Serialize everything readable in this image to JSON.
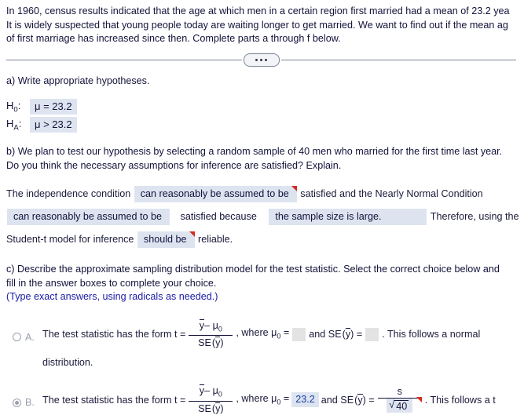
{
  "problem": {
    "line1": "In 1960, census results indicated that the age at which men in a certain region first married had a mean of 23.2 yea",
    "line2": "It is widely suspected that young people today are waiting longer to get married. We want to find out if the mean ag",
    "line3": "of first marriage has increased since then. Complete parts a through f below."
  },
  "divider": {
    "dots_label": "..."
  },
  "part_a": {
    "prompt": "a) Write appropriate hypotheses.",
    "null_label": "H",
    "null_sub": "0",
    "null_value": "μ = 23.2",
    "alt_label": "H",
    "alt_sub": "A",
    "alt_value": "μ > 23.2",
    "colon": ":"
  },
  "part_b": {
    "prompt_line1": "b) We plan to test our hypothesis by selecting a random sample of 40 men who married for the first time last year.",
    "prompt_line2": "Do you think the necessary assumptions for inference are satisfied? Explain.",
    "text1": "The independence condition",
    "dropdown1": "can reasonably be assumed to be",
    "text2": "satisfied and the Nearly Normal Condition",
    "dropdown2": "can reasonably be assumed to be",
    "dropdown3": "satisfied because",
    "dropdown4": "the sample size is large.",
    "text3": "Therefore, using the",
    "text4": "Student-t model for inference",
    "dropdown5": "should be",
    "text5": "reliable."
  },
  "part_c": {
    "prompt_line1": "c) Describe the approximate sampling distribution model for the test statistic. Select the correct choice below and",
    "prompt_line2": "fill in the answer boxes to complete your choice.",
    "note": "(Type exact answers, using radicals as needed.)",
    "choices": [
      {
        "letter": "A.",
        "selected": false,
        "lead": "The test statistic has the form t =",
        "num_ybar": "y",
        "num_minus": "– μ",
        "num_sub": "0",
        "den_se": "SE",
        "den_ybar": "y",
        "where_text": ", where μ",
        "where_sub": "0",
        "equals": "=",
        "mu_value": "",
        "and_text": "and SE",
        "se_ybar": "y",
        "se_equals": "=",
        "se_value": "",
        "tail": ". This follows a normal",
        "second_line": "distribution."
      },
      {
        "letter": "B.",
        "selected": true,
        "lead": "The test statistic has the form t =",
        "num_ybar": "y",
        "num_minus": "– μ",
        "num_sub": "0",
        "den_se": "SE",
        "den_ybar": "y",
        "where_text": ", where μ",
        "where_sub": "0",
        "equals": "=",
        "mu_value": "23.2",
        "and_text": "and SE",
        "se_ybar": "y",
        "se_equals": "=",
        "se_numerator": "s",
        "se_sqrt_symbol": "√",
        "se_sqrt_value": "40",
        "tail": ". This follows a t",
        "second_line": ""
      }
    ]
  },
  "colors": {
    "text": "#12123a",
    "note_blue": "#1a1aa8",
    "answer_fill": "#dde4f0",
    "answer_text_blue": "#1d3fa0",
    "empty_box": "#e3e3e3",
    "flag_red": "#d52b1e",
    "radio_gray": "#9aa0ab"
  }
}
